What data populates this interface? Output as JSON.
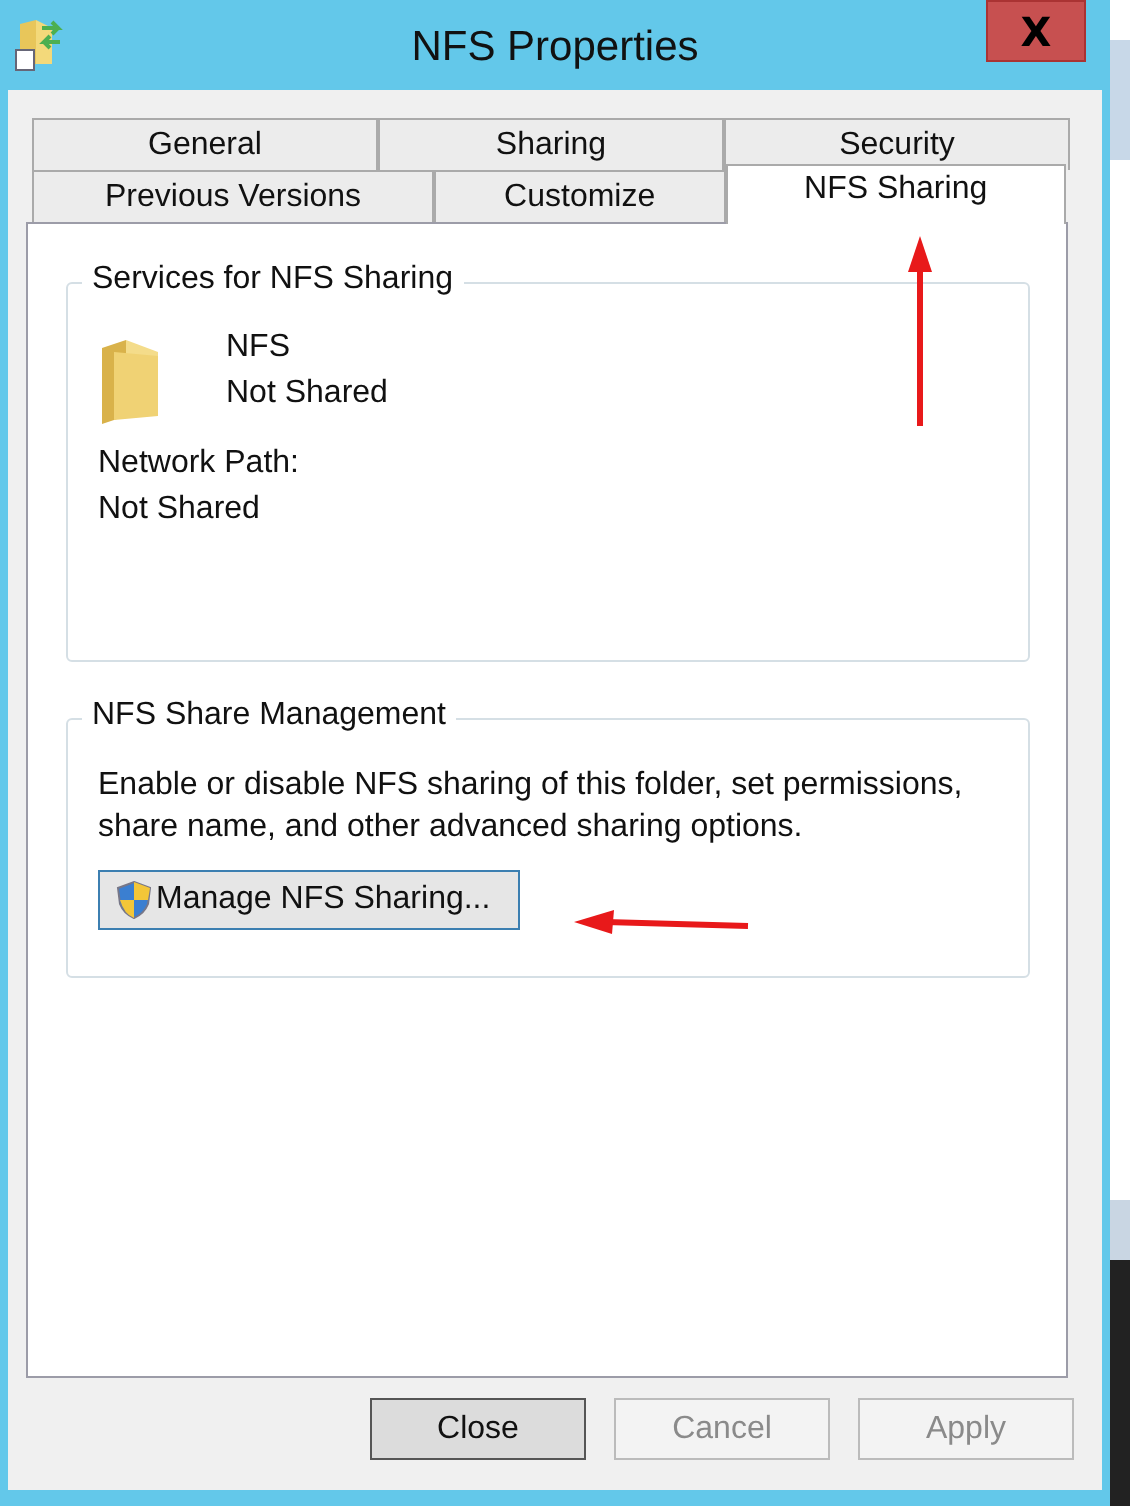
{
  "window": {
    "title": "NFS Properties",
    "close_label": "X"
  },
  "tab_rows": [
    [
      {
        "label": "General",
        "selected": false
      },
      {
        "label": "Sharing",
        "selected": false
      },
      {
        "label": "Security",
        "selected": false
      }
    ],
    [
      {
        "label": "Previous Versions",
        "selected": false
      },
      {
        "label": "Customize",
        "selected": false
      },
      {
        "label": "NFS Sharing",
        "selected": true
      }
    ]
  ],
  "services_group": {
    "title": "Services for NFS Sharing",
    "folder_name": "NFS",
    "folder_status": "Not Shared",
    "path_label": "Network Path:",
    "path_value": "Not Shared"
  },
  "management_group": {
    "title": "NFS Share Management",
    "description": "Enable or disable NFS sharing of this folder, set permissions, share name, and other advanced sharing options.",
    "button": "Manage NFS Sharing..."
  },
  "buttons": [
    {
      "label": "Close",
      "disabled": false,
      "default": true
    },
    {
      "label": "Cancel",
      "disabled": true,
      "default": false
    },
    {
      "label": "Apply",
      "disabled": true,
      "default": false
    }
  ],
  "arrows": [
    {
      "kind": "upward"
    },
    {
      "kind": "leftward"
    }
  ]
}
